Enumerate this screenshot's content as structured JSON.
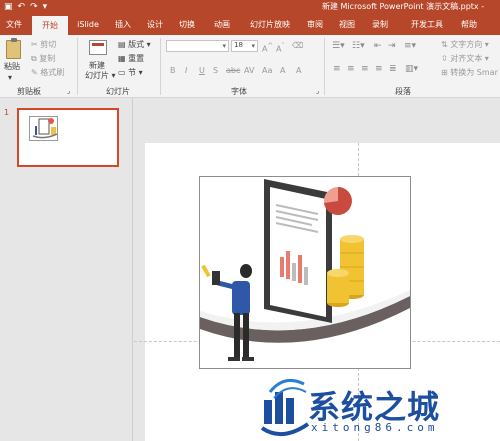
{
  "window": {
    "title": "新建 Microsoft PowerPoint 演示文稿.pptx -",
    "qat": {
      "save_icon": "save-icon",
      "undo_icon": "undo-icon",
      "redo_icon": "redo-icon",
      "customize": "▾"
    }
  },
  "tabs": [
    "文件",
    "开始",
    "iSlide",
    "插入",
    "设计",
    "切换",
    "动画",
    "幻灯片放映",
    "审阅",
    "视图",
    "录制",
    "开发工具",
    "帮助"
  ],
  "active_tab": "开始",
  "ribbon": {
    "clipboard": {
      "paste": "粘贴",
      "cut": "剪切",
      "copy": "复制",
      "format_painter": "格式刷",
      "group": "剪贴板"
    },
    "slides": {
      "new_slide_line1": "新建",
      "new_slide_line2": "幻灯片",
      "layout": "版式",
      "reset": "重置",
      "section": "节",
      "group": "幻灯片"
    },
    "font": {
      "font_name": "",
      "font_size": "18",
      "group": "字体",
      "buttons": [
        "B",
        "I",
        "U",
        "S",
        "abc",
        "AV",
        "Aa",
        "A",
        "A"
      ]
    },
    "paragraph": {
      "text_direction": "文字方向",
      "align_text": "对齐文本",
      "convert_smartart": "转换为 Smar",
      "group": "段落"
    }
  },
  "thumbnails": {
    "slide_number": "1"
  },
  "watermark": {
    "brand": "系统之城",
    "url": "xitong86.com"
  },
  "colors": {
    "accent": "#b7472a",
    "ribbon_bg": "#f3f3f3",
    "workspace": "#e6e6e6",
    "watermark": "#1c4fa0"
  }
}
